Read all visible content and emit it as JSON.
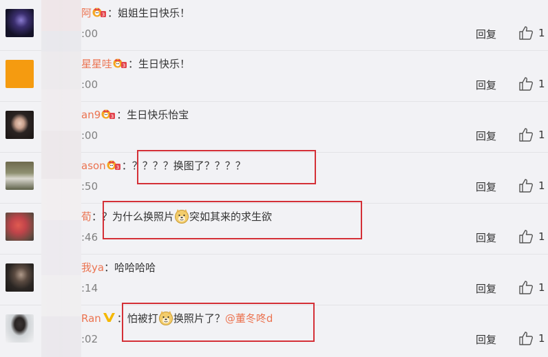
{
  "comments": [
    {
      "username": "阿",
      "badge": "crown-badge",
      "text": "：姐姐生日快乐！",
      "time": ":00",
      "reply_label": "回复",
      "likes": "1",
      "avatar_color": "#1d1a38"
    },
    {
      "username": "星星哇",
      "badge": "crown-badge",
      "text": "：生日快乐！",
      "time": ":00",
      "reply_label": "回复",
      "likes": "1",
      "avatar_color": "#f59b10"
    },
    {
      "username": "an9",
      "badge": "crown-badge",
      "text": "：生日快乐怡宝",
      "time": ":00",
      "reply_label": "回复",
      "likes": "1",
      "avatar_color": "#2a2322"
    },
    {
      "username": "ason",
      "badge": "crown-badge",
      "text": "：？？？？换图了？？？？",
      "time": ":50",
      "reply_label": "回复",
      "likes": "1",
      "avatar_color": "#8a8c6a"
    },
    {
      "username": "荀",
      "text_before": "：？为什么换照片",
      "emoji": "doge-emoji",
      "text_after": "突如其来的求生欲",
      "time": ":46",
      "reply_label": "回复",
      "likes": "1",
      "avatar_color": "#c0444a"
    },
    {
      "username": "我ya",
      "text": "：哈哈哈哈",
      "time": ":14",
      "reply_label": "回复",
      "likes": "1",
      "avatar_color": "#2c2724"
    },
    {
      "username": "Ran",
      "badge": "verified-v-badge",
      "text_before": "：怕被打",
      "emoji": "doge-emoji",
      "text_after": "换照片了？",
      "mention": "@董冬咚d",
      "time": ":02",
      "reply_label": "回复",
      "likes": "1",
      "avatar_color": "#e9e9ec"
    }
  ],
  "colors": {
    "username": "#eb7350",
    "highlight_box": "#d42f36",
    "background": "#f2f2f5"
  }
}
